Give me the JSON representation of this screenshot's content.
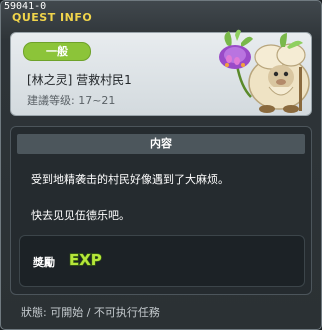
{
  "window": {
    "quest_id": "59041-0",
    "title": "QUEST INFO"
  },
  "quest": {
    "category": "一般",
    "name": "[林之灵] 营救村民1",
    "recommended_level": "建議等级: 17~21",
    "npc_icon": "sheep-villager-with-flower-icon"
  },
  "content": {
    "header": "内容",
    "lines": [
      "受到地精袭击的村民好像遇到了大麻烦。",
      "快去见见伍德乐吧。"
    ]
  },
  "reward": {
    "label": "獎勵",
    "icon": "exp-icon",
    "icon_text": "EXP"
  },
  "status": {
    "text": "狀態: 可開始 / 不可执行任務"
  },
  "colors": {
    "title_yellow": "#f0d44b",
    "badge_green": "#8cc439",
    "exp_green": "#b6e63a"
  }
}
